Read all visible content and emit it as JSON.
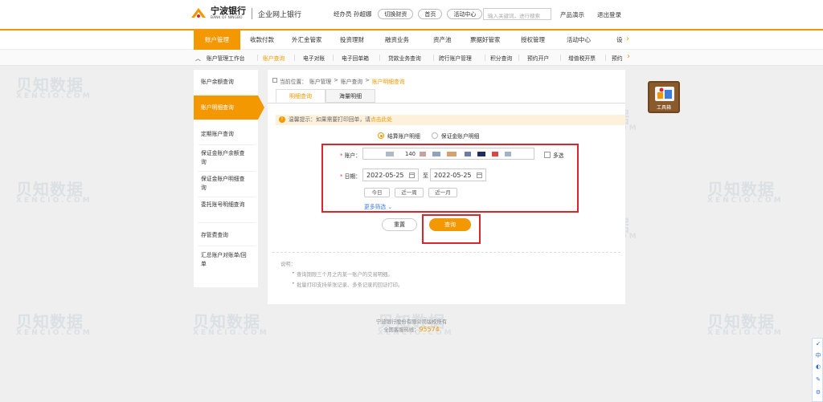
{
  "header": {
    "logo_cn": "宁波银行",
    "logo_en": "BANK OF NINGBO",
    "system_name": "企业网上银行",
    "operator_label": "经办员 孙超娜",
    "buttons": [
      "切换财资",
      "首页",
      "活动中心"
    ],
    "search_placeholder": "输入关键词，进行搜索",
    "links": [
      "产品演示",
      "退出登录"
    ]
  },
  "nav1": {
    "items": [
      "账户管理",
      "收款付款",
      "外汇金管家",
      "投资理财",
      "融资业务",
      "资产池",
      "票据好管家",
      "授权管理",
      "活动中心",
      "设"
    ],
    "active": "账户管理"
  },
  "nav2": {
    "items": [
      "账户管理工作台",
      "账户查询",
      "电子对账",
      "电子回单箱",
      "贷款业务查询",
      "跨行账户管理",
      "积分查询",
      "预约开户",
      "增值税开票",
      "预约"
    ],
    "active": "账户查询"
  },
  "left_menu": {
    "items": [
      "账户余额查询",
      "账户明细查询",
      "定期账户查询",
      "保证金账户余额查询",
      "保证金账户明细查询",
      "委托账号明细查询",
      "存管费查询",
      "汇总账户对账单/回单"
    ],
    "active": "账户明细查询"
  },
  "breadcrumb": {
    "prefix": "当前位置：",
    "parts": [
      "账户管理",
      ">",
      "账户查询",
      ">"
    ],
    "current": "账户明细查询"
  },
  "tabs": [
    "明细查询",
    "海量明细"
  ],
  "notice": {
    "text": "温馨提示：如果需要打印回单，请",
    "link": "点击此处"
  },
  "radios": [
    {
      "label": "结算账户明细",
      "selected": true
    },
    {
      "label": "保证金账户明细",
      "selected": false
    }
  ],
  "form": {
    "account_label": "账户：",
    "account_value": "140",
    "multi_label": "多选",
    "date_label": "日期：",
    "date_from": "2022-05-25",
    "date_to": "2022-05-25",
    "date_sep": "至",
    "quick": [
      "今日",
      "近一周",
      "近一月"
    ],
    "more": "更多筛选"
  },
  "actions": {
    "reset": "重置",
    "query": "查询"
  },
  "notes": {
    "title": "说明：",
    "items": [
      "查询期限三个月之内某一账户的交易明细。",
      "批量打印支持单张记录、多条记录的回证打印。"
    ]
  },
  "footer": {
    "copyright": "宁波银行股份有限公司版权所有",
    "hotline_label": "全国客服热线：",
    "hotline": "95574"
  },
  "toolbox_label": "工具箱",
  "side_tools": [
    "↙",
    "中",
    "◐",
    "✎",
    "⚙"
  ],
  "watermark": {
    "cn": "贝知数据",
    "en": "XENCIO.COM"
  },
  "colors": {
    "accent": "#f39800",
    "highlight_box": "#d9262c",
    "link": "#3b7ddd"
  }
}
